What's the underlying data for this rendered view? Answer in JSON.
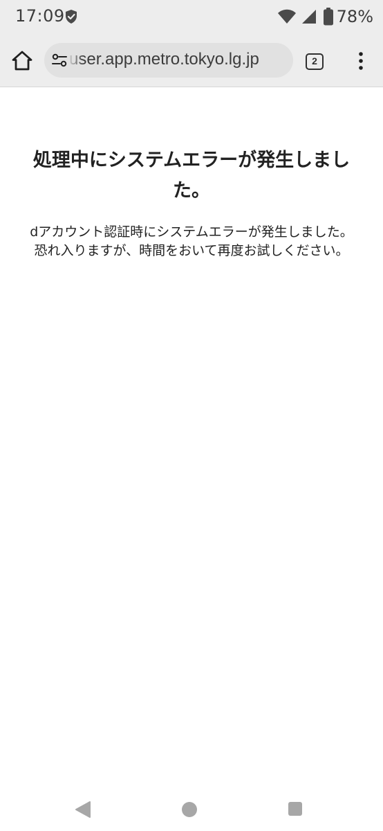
{
  "status_bar": {
    "time": "17:09",
    "battery_percent": "78%"
  },
  "browser": {
    "url": "user.app.metro.tokyo.lg.jp",
    "tab_count": "2"
  },
  "page": {
    "title": "処理中にシステムエラーが発生しました。",
    "message_line1": "dアカウント認証時にシステムエラーが発生しました。",
    "message_line2": "恐れ入りますが、時間をおいて再度お試しください。"
  }
}
